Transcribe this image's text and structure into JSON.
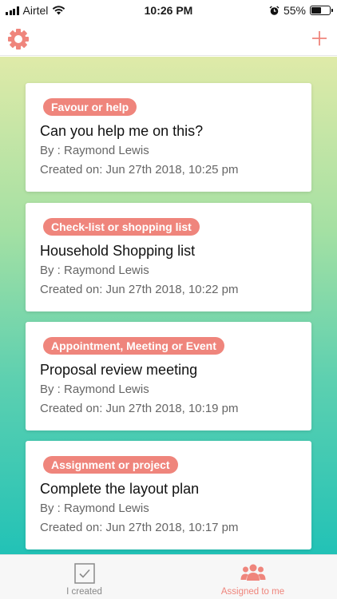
{
  "status_bar": {
    "carrier": "Airtel",
    "time": "10:26 PM",
    "battery_percent_text": "55%",
    "battery_level": 0.55
  },
  "nav": {
    "settings_icon": "gear-icon",
    "add_icon": "plus-icon"
  },
  "tasks": [
    {
      "category": "Favour or help",
      "title": "Can you help me on this?",
      "by": "By : Raymond Lewis",
      "created": "Created on: Jun 27th 2018, 10:25 pm"
    },
    {
      "category": "Check-list or shopping list",
      "title": "Household Shopping list",
      "by": "By : Raymond Lewis",
      "created": "Created on: Jun 27th 2018, 10:22 pm"
    },
    {
      "category": "Appointment, Meeting or Event",
      "title": "Proposal review meeting",
      "by": "By : Raymond Lewis",
      "created": "Created on: Jun 27th 2018, 10:19 pm"
    },
    {
      "category": "Assignment or project",
      "title": "Complete the layout plan",
      "by": "By : Raymond Lewis",
      "created": "Created on: Jun 27th 2018, 10:17 pm"
    }
  ],
  "tabs": [
    {
      "label": "I created",
      "icon": "checkbox-icon",
      "active": false
    },
    {
      "label": "Assigned to me",
      "icon": "people-icon",
      "active": true
    }
  ],
  "colors": {
    "accent": "#ef857c",
    "gradient_top": "#dfeaa8",
    "gradient_bottom": "#22c2b6"
  }
}
